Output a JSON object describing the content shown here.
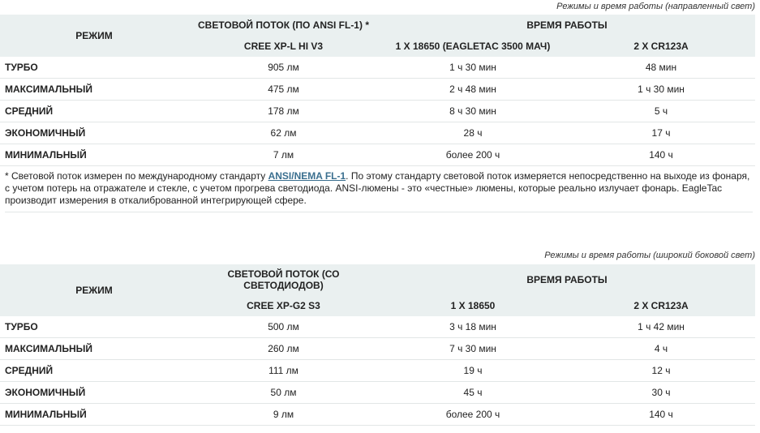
{
  "table1": {
    "caption": "Режимы и время работы (направленный свет)",
    "header": {
      "mode": "РЕЖИМ",
      "flux_group": "СВЕТОВОЙ ПОТОК (ПО ANSI FL-1) *",
      "runtime_group": "ВРЕМЯ РАБОТЫ",
      "flux_sub": "CREE XP-L HI V3",
      "run1_sub": "1 X 18650 (EAGLETAC 3500 МАЧ)",
      "run2_sub": "2 X CR123A"
    },
    "rows": [
      {
        "mode": "ТУРБО",
        "flux": "905 лм",
        "run1": "1 ч 30 мин",
        "run2": "48 мин"
      },
      {
        "mode": "МАКСИМАЛЬНЫЙ",
        "flux": "475 лм",
        "run1": "2 ч 48 мин",
        "run2": "1 ч 30 мин"
      },
      {
        "mode": "СРЕДНИЙ",
        "flux": "178 лм",
        "run1": "8 ч 30 мин",
        "run2": "5 ч"
      },
      {
        "mode": "ЭКОНОМИЧНЫЙ",
        "flux": "62 лм",
        "run1": "28 ч",
        "run2": "17 ч"
      },
      {
        "mode": "МИНИМАЛЬНЫЙ",
        "flux": "7 лм",
        "run1": "более 200 ч",
        "run2": "140 ч"
      }
    ]
  },
  "footnote": {
    "prefix": "* Световой поток измерен по международному стандарту ",
    "link": "ANSI/NEMA FL-1",
    "suffix": ". По этому стандарту световой поток измеряется непосредственно на выходе из фонаря, с учетом потерь на отражателе и стекле, с учетом прогрева светодиода. ANSI-люмены - это «честные» люмены, которые реально излучает фонарь. EagleTac производит измерения в откалиброванной интегрирующей сфере."
  },
  "table2": {
    "caption": "Режимы и время работы (широкий боковой свет)",
    "header": {
      "mode": "РЕЖИМ",
      "flux_group": "СВЕТОВОЙ ПОТОК (СО СВЕТОДИОДОВ)",
      "runtime_group": "ВРЕМЯ РАБОТЫ",
      "flux_sub": "CREE XP-G2 S3",
      "run1_sub": "1 X 18650",
      "run2_sub": "2 X CR123A"
    },
    "rows": [
      {
        "mode": "ТУРБО",
        "flux": "500 лм",
        "run1": "3 ч 18 мин",
        "run2": "1 ч 42 мин"
      },
      {
        "mode": "МАКСИМАЛЬНЫЙ",
        "flux": "260 лм",
        "run1": "7 ч 30 мин",
        "run2": "4 ч"
      },
      {
        "mode": "СРЕДНИЙ",
        "flux": "111 лм",
        "run1": "19 ч",
        "run2": "12 ч"
      },
      {
        "mode": "ЭКОНОМИЧНЫЙ",
        "flux": "50 лм",
        "run1": "45 ч",
        "run2": "30 ч"
      },
      {
        "mode": "МИНИМАЛЬНЫЙ",
        "flux": "9 лм",
        "run1": "более 200 ч",
        "run2": "140 ч"
      }
    ]
  }
}
